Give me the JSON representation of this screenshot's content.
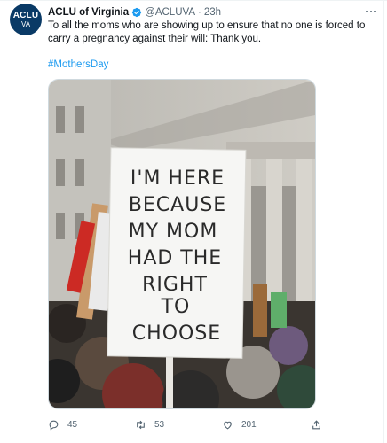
{
  "tweet": {
    "avatar_line1": "ACLU",
    "avatar_line2": "VA",
    "name": "ACLU of Virginia",
    "handle": "@ACLUVA",
    "separator": "·",
    "time": "23h",
    "text": "To all the moms who are showing up to ensure that no one is forced to carry a pregnancy against their will: Thank you.",
    "hashtag": "#MothersDay",
    "image": {
      "sign_lines": [
        "I'M HERE",
        "BECAUSE",
        "MY MOM",
        "HAD THE",
        "RIGHT",
        "TO",
        "CHOOSE"
      ]
    },
    "actions": {
      "replies": "45",
      "retweets": "53",
      "likes": "201"
    }
  },
  "colors": {
    "verified": "#1d9bf0",
    "link": "#1d9bf0",
    "muted": "#536471",
    "avatar": "#0a3a66"
  },
  "icons": [
    "verified-badge-icon",
    "more-icon",
    "reply-icon",
    "retweet-icon",
    "like-icon",
    "share-icon"
  ]
}
